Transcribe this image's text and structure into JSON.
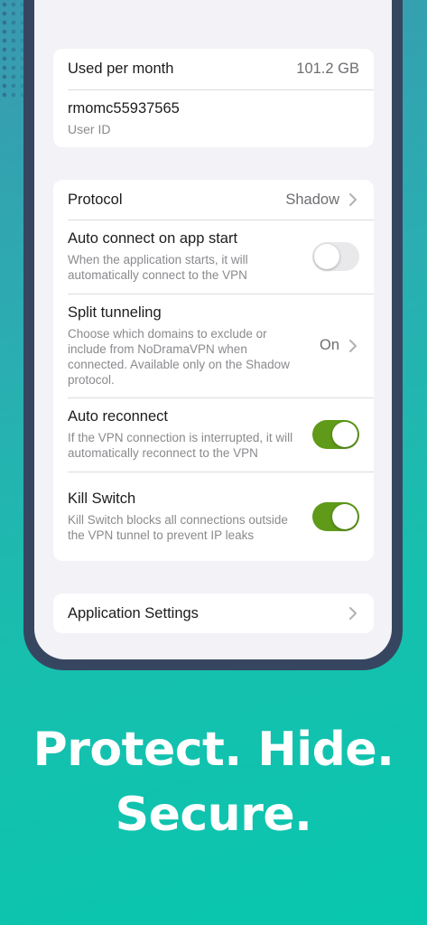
{
  "account": {
    "usage_label": "Used per month",
    "usage_value": "101.2 GB",
    "user_id_value": "rmomc55937565",
    "user_id_label": "User ID"
  },
  "settings": {
    "protocol": {
      "label": "Protocol",
      "value": "Shadow"
    },
    "auto_connect": {
      "label": "Auto connect on app start",
      "description": "When the application starts, it will automatically connect to the VPN",
      "enabled": false
    },
    "split_tunneling": {
      "label": "Split tunneling",
      "description": "Choose which domains to exclude or include from NoDramaVPN when connected. Available only on the Shadow protocol.",
      "value": "On"
    },
    "auto_reconnect": {
      "label": "Auto reconnect",
      "description": "If the VPN connection is interrupted, it will automatically reconnect to the VPN",
      "enabled": true
    },
    "kill_switch": {
      "label": "Kill Switch",
      "description": "Kill Switch blocks all connections outside the VPN tunnel to prevent IP leaks",
      "enabled": true
    }
  },
  "app_settings": {
    "label": "Application Settings"
  },
  "promo": {
    "line1": "Protect. Hide.",
    "line2": "Secure."
  },
  "colors": {
    "toggle_on": "#5f9a18",
    "background_gradient": [
      "#3a99b0",
      "#08c7ae"
    ],
    "phone_frame": "#374660"
  },
  "icons": [
    "chevron-right-icon"
  ]
}
